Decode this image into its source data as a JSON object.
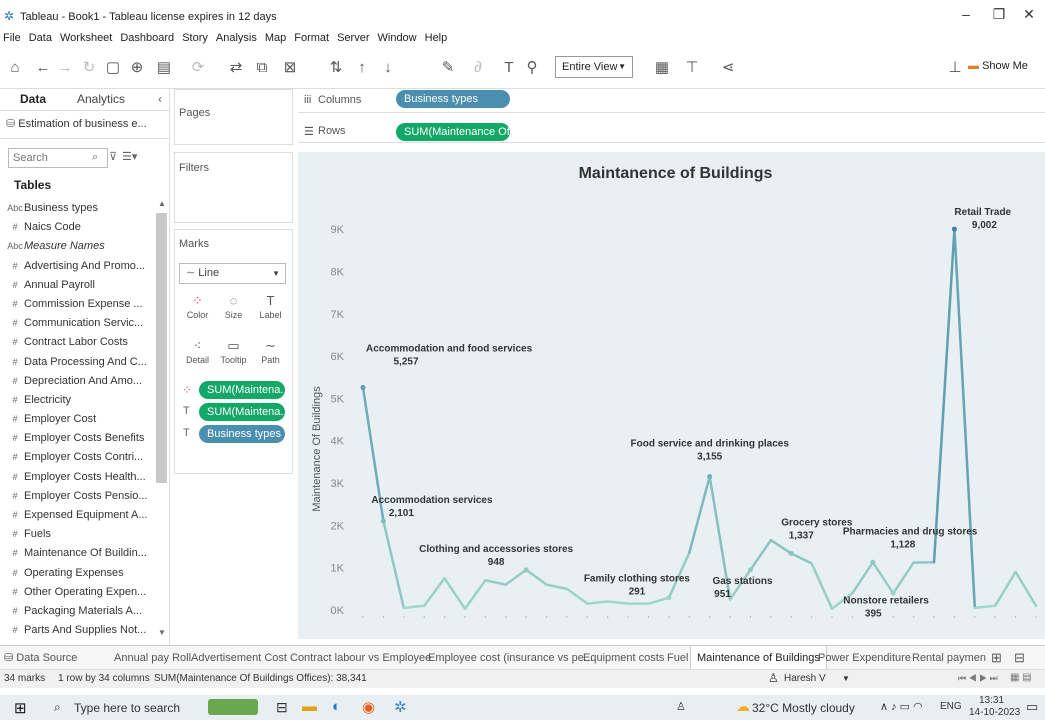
{
  "window": {
    "title": "Tableau - Book1 - Tableau license expires in 12 days",
    "minimize": "–",
    "restore": "❐",
    "close": "✕"
  },
  "menu": [
    "File",
    "Data",
    "Worksheet",
    "Dashboard",
    "Story",
    "Analysis",
    "Map",
    "Format",
    "Server",
    "Window",
    "Help"
  ],
  "toolbar": {
    "fit": "Entire View",
    "show_me": "Show Me"
  },
  "left": {
    "tab_data": "Data",
    "tab_analytics": "Analytics",
    "datasource": "Estimation of business e...",
    "search_placeholder": "Search",
    "tables_header": "Tables",
    "fields": [
      {
        "type": "Abc",
        "name": "Business types"
      },
      {
        "type": "#",
        "name": "Naics Code"
      },
      {
        "type": "Abc",
        "name": "Measure Names"
      },
      {
        "type": "#",
        "name": "Advertising And Promo..."
      },
      {
        "type": "#",
        "name": "Annual Payroll"
      },
      {
        "type": "#",
        "name": "Commission Expense ..."
      },
      {
        "type": "#",
        "name": "Communication Servic..."
      },
      {
        "type": "#",
        "name": "Contract Labor Costs"
      },
      {
        "type": "#",
        "name": "Data Processing And C..."
      },
      {
        "type": "#",
        "name": "Depreciation And Amo..."
      },
      {
        "type": "#",
        "name": "Electricity"
      },
      {
        "type": "#",
        "name": "Employer Cost"
      },
      {
        "type": "#",
        "name": "Employer Costs Benefits"
      },
      {
        "type": "#",
        "name": "Employer Costs Contri..."
      },
      {
        "type": "#",
        "name": "Employer Costs Health..."
      },
      {
        "type": "#",
        "name": "Employer Costs Pensio..."
      },
      {
        "type": "#",
        "name": "Expensed Equipment A..."
      },
      {
        "type": "#",
        "name": "Fuels"
      },
      {
        "type": "#",
        "name": "Maintenance Of Buildin..."
      },
      {
        "type": "#",
        "name": "Operating Expenses"
      },
      {
        "type": "#",
        "name": "Other Operating Expen..."
      },
      {
        "type": "#",
        "name": "Packaging Materials A..."
      },
      {
        "type": "#",
        "name": "Parts And Supplies Not..."
      }
    ]
  },
  "shelves": {
    "pages": "Pages",
    "filters": "Filters",
    "marks": "Marks",
    "columns_label": "Columns",
    "rows_label": "Rows",
    "columns_pill": "Business types",
    "rows_pill": "SUM(Maintenance Of..",
    "mark_type": "Line",
    "cards": [
      "Color",
      "Size",
      "Label",
      "Detail",
      "Tooltip",
      "Path"
    ],
    "mark_pills": [
      "SUM(Maintena..",
      "SUM(Maintena..",
      "Business types"
    ]
  },
  "chart_data": {
    "type": "line",
    "title": "Maintanence of Buildings",
    "ylabel": "Maintenance Of Buildings",
    "xlabel": "",
    "ylim": [
      0,
      9500
    ],
    "yticks": [
      "0K",
      "1K",
      "2K",
      "3K",
      "4K",
      "5K",
      "6K",
      "7K",
      "8K",
      "9K"
    ],
    "y": [
      5257,
      2101,
      50,
      100,
      750,
      30,
      700,
      600,
      948,
      600,
      500,
      150,
      200,
      150,
      150,
      291,
      1350,
      3155,
      250,
      951,
      1650,
      1337,
      1100,
      30,
      400,
      1128,
      395,
      1120,
      1128,
      9002,
      50,
      100,
      900,
      100
    ],
    "labels": [
      {
        "index": 0,
        "name": "Accommodation and food services",
        "value": "5,257"
      },
      {
        "index": 1,
        "name": "Accommodation services",
        "value": "2,101"
      },
      {
        "index": 8,
        "name": "Clothing and accessories stores",
        "value": "948"
      },
      {
        "index": 15,
        "name": "Family clothing stores",
        "value": "291"
      },
      {
        "index": 17,
        "name": "Food service and drinking places",
        "value": "3,155"
      },
      {
        "index": 19,
        "name": "Gas stations",
        "value": "951"
      },
      {
        "index": 21,
        "name": "Grocery stores",
        "value": "1,337"
      },
      {
        "index": 25,
        "name": "Pharmacies and drug stores",
        "value": "1,128"
      },
      {
        "index": 26,
        "name": "Nonstore retailers",
        "value": "395"
      },
      {
        "index": 29,
        "name": "Retail Trade",
        "value": "9,002"
      }
    ]
  },
  "sheet_tabs": [
    "Data Source",
    "Annual pay Roll",
    "Advertisement Cost",
    "Contract labour vs Employee",
    "Employee cost (insurance vs pe...",
    "Equipment costs",
    "Fuel",
    "Maintenance of Buildings",
    "Power Expenditure",
    "Rental payment f"
  ],
  "active_tab": "Maintenance of Buildings",
  "status": {
    "marks": "34 marks",
    "dims": "1 row by 34 columns",
    "sum": "SUM(Maintenance Of Buildings Offices): 38,341",
    "user": "Haresh V"
  },
  "taskbar": {
    "search": "Type here to search",
    "weather": "32°C  Mostly cloudy",
    "lang": "ENG",
    "time": "13:31",
    "date": "14-10-2023"
  },
  "colors": {
    "accent_blue": "#4b8fb0",
    "pill_green": "#13a867",
    "line_light": "#a6dccd",
    "line_dark": "#3a7ca5"
  }
}
